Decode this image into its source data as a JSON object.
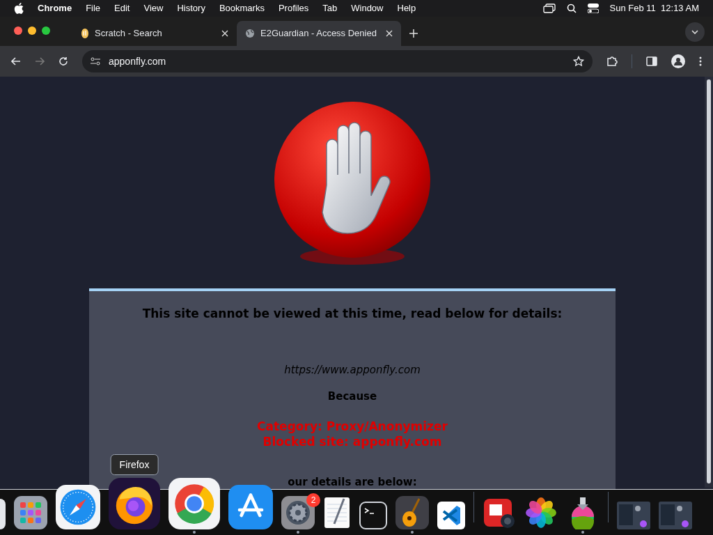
{
  "menu_bar": {
    "app": "Chrome",
    "items": [
      "File",
      "Edit",
      "View",
      "History",
      "Bookmarks",
      "Profiles",
      "Tab",
      "Window",
      "Help"
    ],
    "clock": "Sun Feb 11  12:13 AM"
  },
  "tabs": [
    {
      "title": "Scratch - Search",
      "kind": "scratch",
      "selected": false
    },
    {
      "title": "E2Guardian - Access Denied",
      "kind": "globe",
      "selected": true
    }
  ],
  "address": "apponfly.com",
  "page": {
    "heading": "This site cannot be viewed at this time, read below for details:",
    "url": "https://www.apponfly.com",
    "because": "Because",
    "reasons": [
      "Category: Proxy/Anonymizer",
      "Blocked site: apponfly.com"
    ],
    "details": "our details are below:"
  },
  "dock": {
    "tooltip": "Firefox",
    "items": [
      {
        "kind": "edge",
        "running": false
      },
      {
        "kind": "launchpad",
        "running": false
      },
      {
        "kind": "safari",
        "running": false
      },
      {
        "kind": "firefox",
        "running": false,
        "hovered": true
      },
      {
        "kind": "chrome",
        "running": true
      },
      {
        "kind": "appstore",
        "running": false
      },
      {
        "kind": "settings",
        "running": true,
        "badge": "2"
      },
      {
        "kind": "textedit",
        "running": false
      },
      {
        "kind": "terminal",
        "running": false
      },
      {
        "kind": "garageband",
        "running": true
      },
      {
        "kind": "vscode",
        "running": false
      },
      {
        "kind": "separator"
      },
      {
        "kind": "photobooth",
        "running": false
      },
      {
        "kind": "photos",
        "running": false
      },
      {
        "kind": "installer",
        "running": true
      },
      {
        "kind": "separator"
      },
      {
        "kind": "window",
        "running": false
      },
      {
        "kind": "window",
        "running": false
      }
    ]
  }
}
